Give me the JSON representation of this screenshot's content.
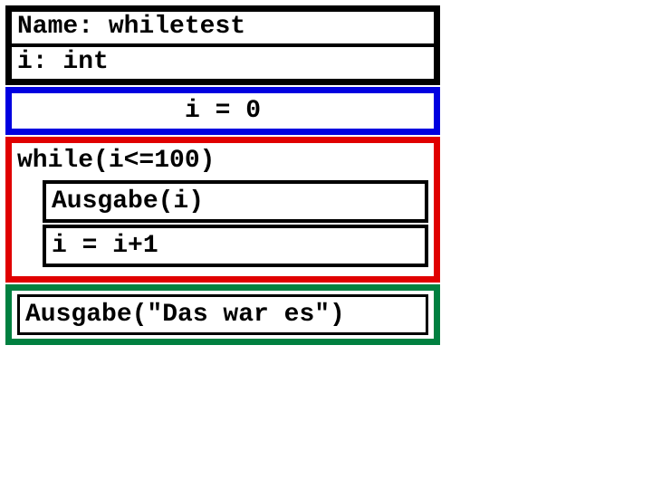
{
  "header": {
    "name_label": "Name:",
    "name_value": "whiletest",
    "var_decl": "i: int"
  },
  "init": {
    "stmt": "i = 0"
  },
  "loop": {
    "condition": "while(i<=100)",
    "body": [
      "Ausgabe(i)",
      "i = i+1"
    ]
  },
  "after": {
    "stmt": "Ausgabe(\"Das war es\")"
  }
}
